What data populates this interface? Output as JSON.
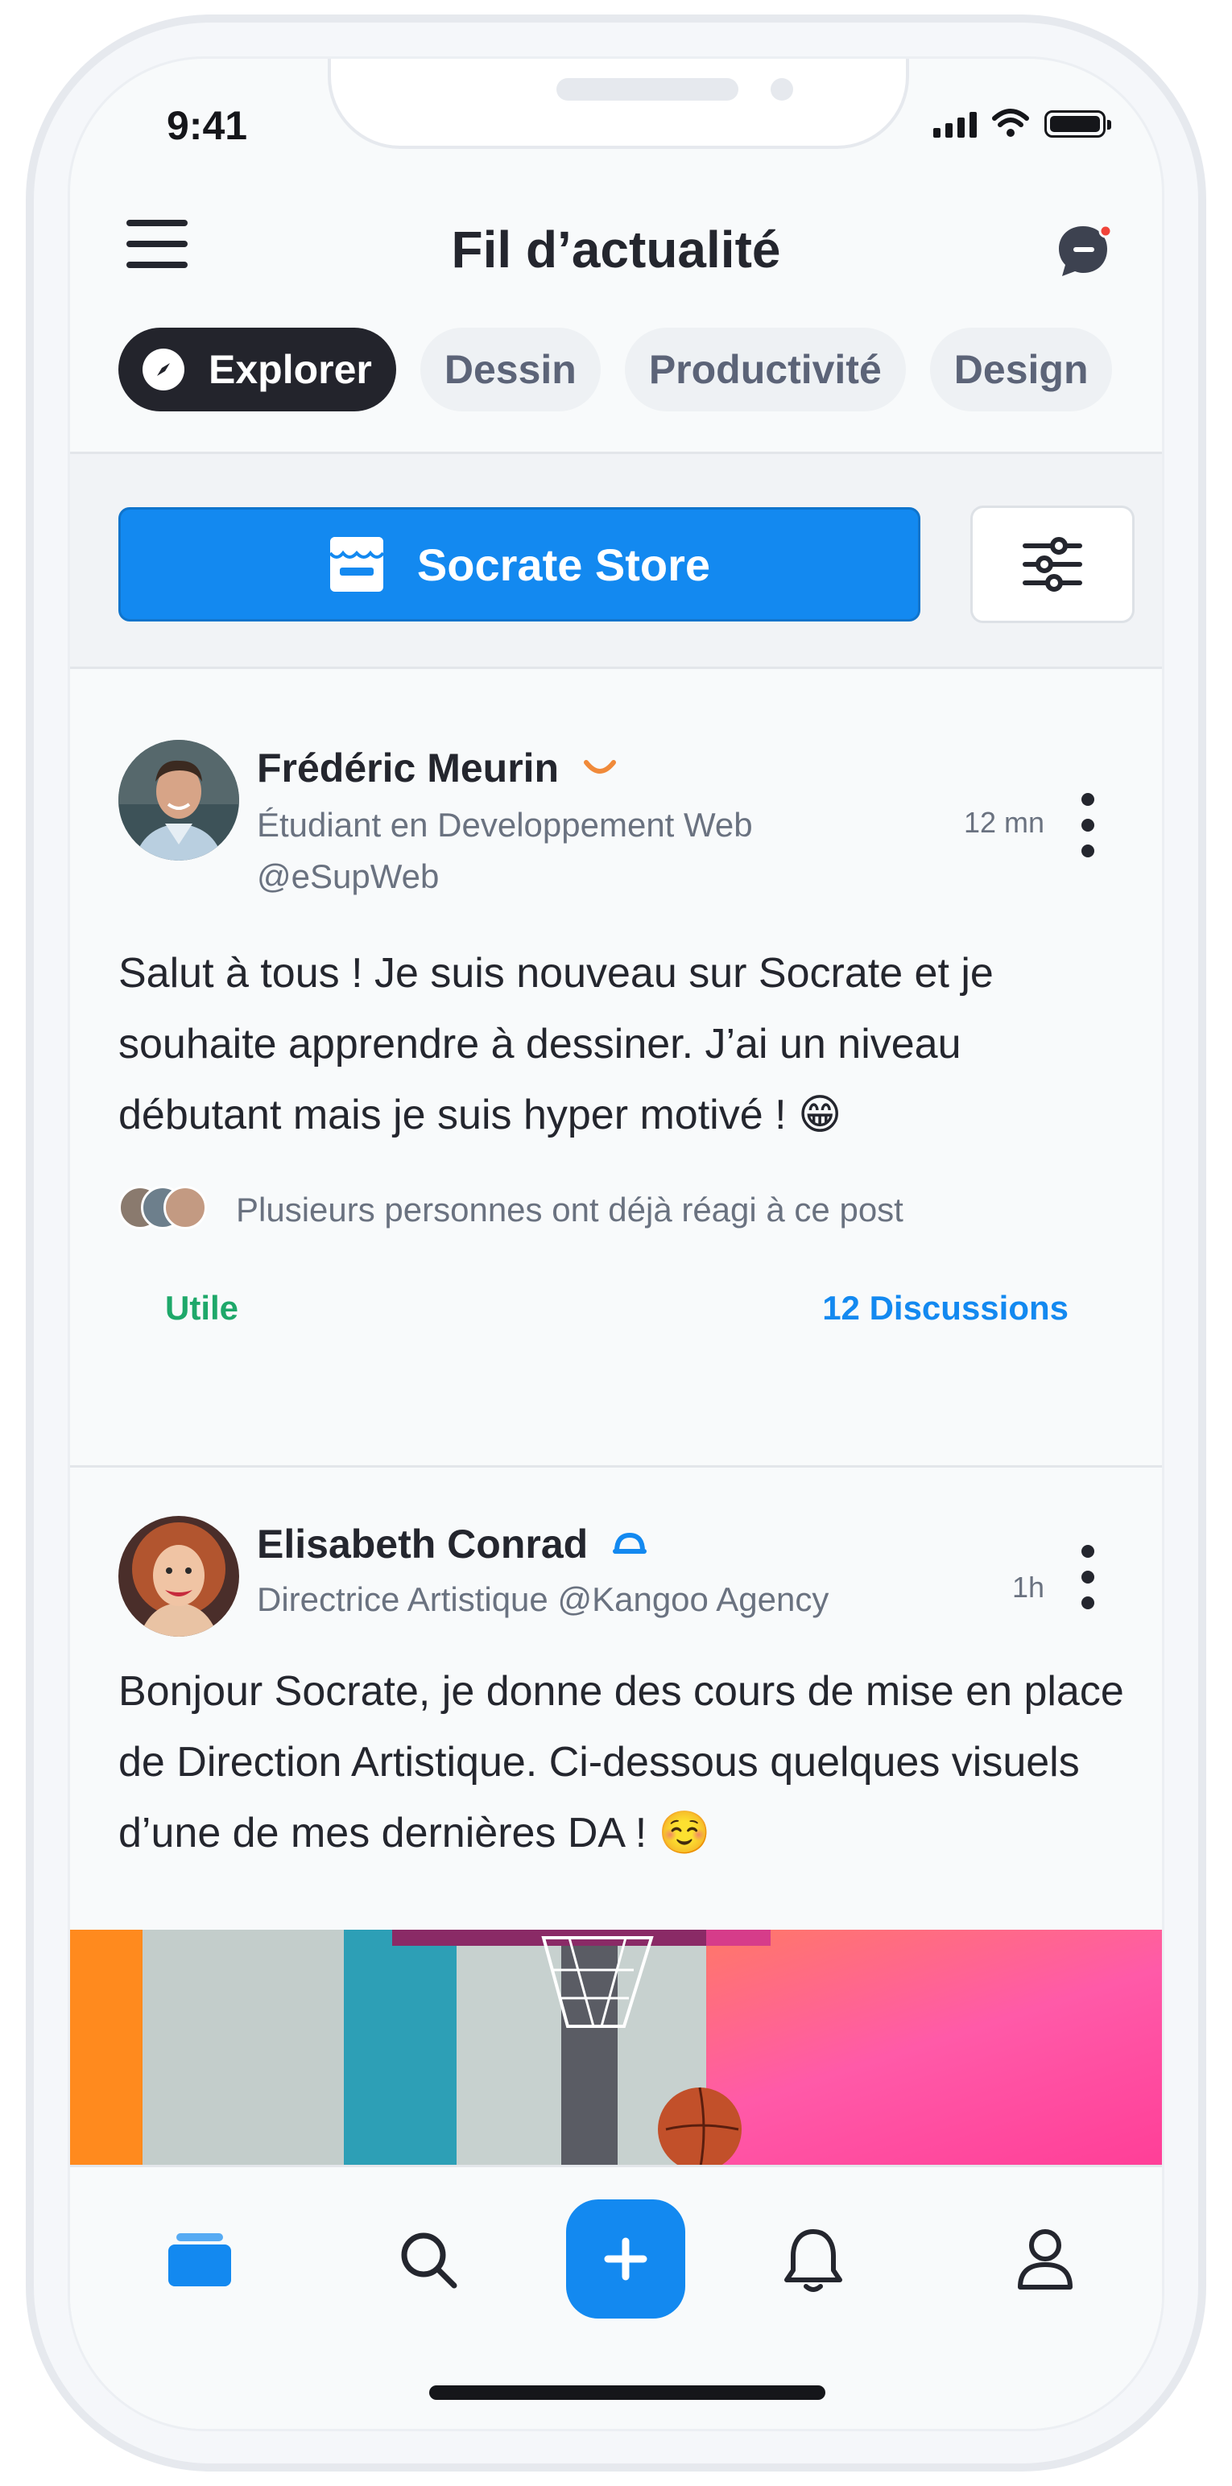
{
  "status_bar": {
    "time": "9:41"
  },
  "header": {
    "title": "Fil d’actualité"
  },
  "chips": [
    {
      "label": "Explorer",
      "active": true
    },
    {
      "label": "Dessin",
      "active": false
    },
    {
      "label": "Productivité",
      "active": false
    },
    {
      "label": "Design",
      "active": false
    }
  ],
  "store": {
    "label": "Socrate Store"
  },
  "posts": [
    {
      "author": "Frédéric Meurin",
      "role": "Étudiant en Developpement Web",
      "handle": "@eSupWeb",
      "time": "12 mn",
      "text": "Salut à tous ! Je suis nouveau sur Socrate et je souhaite apprendre à dessiner. J’ai un niveau débutant mais je suis hyper motivé ! 😁",
      "reactions_text": "Plusieurs personnes ont déjà réagi à ce post",
      "useful_label": "Utile",
      "discussions_label": "12 Discussions",
      "badge_color": "#f08a3a"
    },
    {
      "author": "Elisabeth Conrad",
      "role": "Directrice Artistique @Kangoo Agency",
      "time": "1h",
      "text": "Bonjour Socrate, je donne des cours de mise en place de Direction Artistique. Ci-dessous quelques visuels d’une de mes dernières DA ! ☺️",
      "badge_color": "#1389f0"
    }
  ],
  "tabbar": {
    "items": [
      "home-icon",
      "search-icon",
      "plus-icon",
      "bell-icon",
      "profile-icon"
    ],
    "accent": "#1389f0"
  }
}
